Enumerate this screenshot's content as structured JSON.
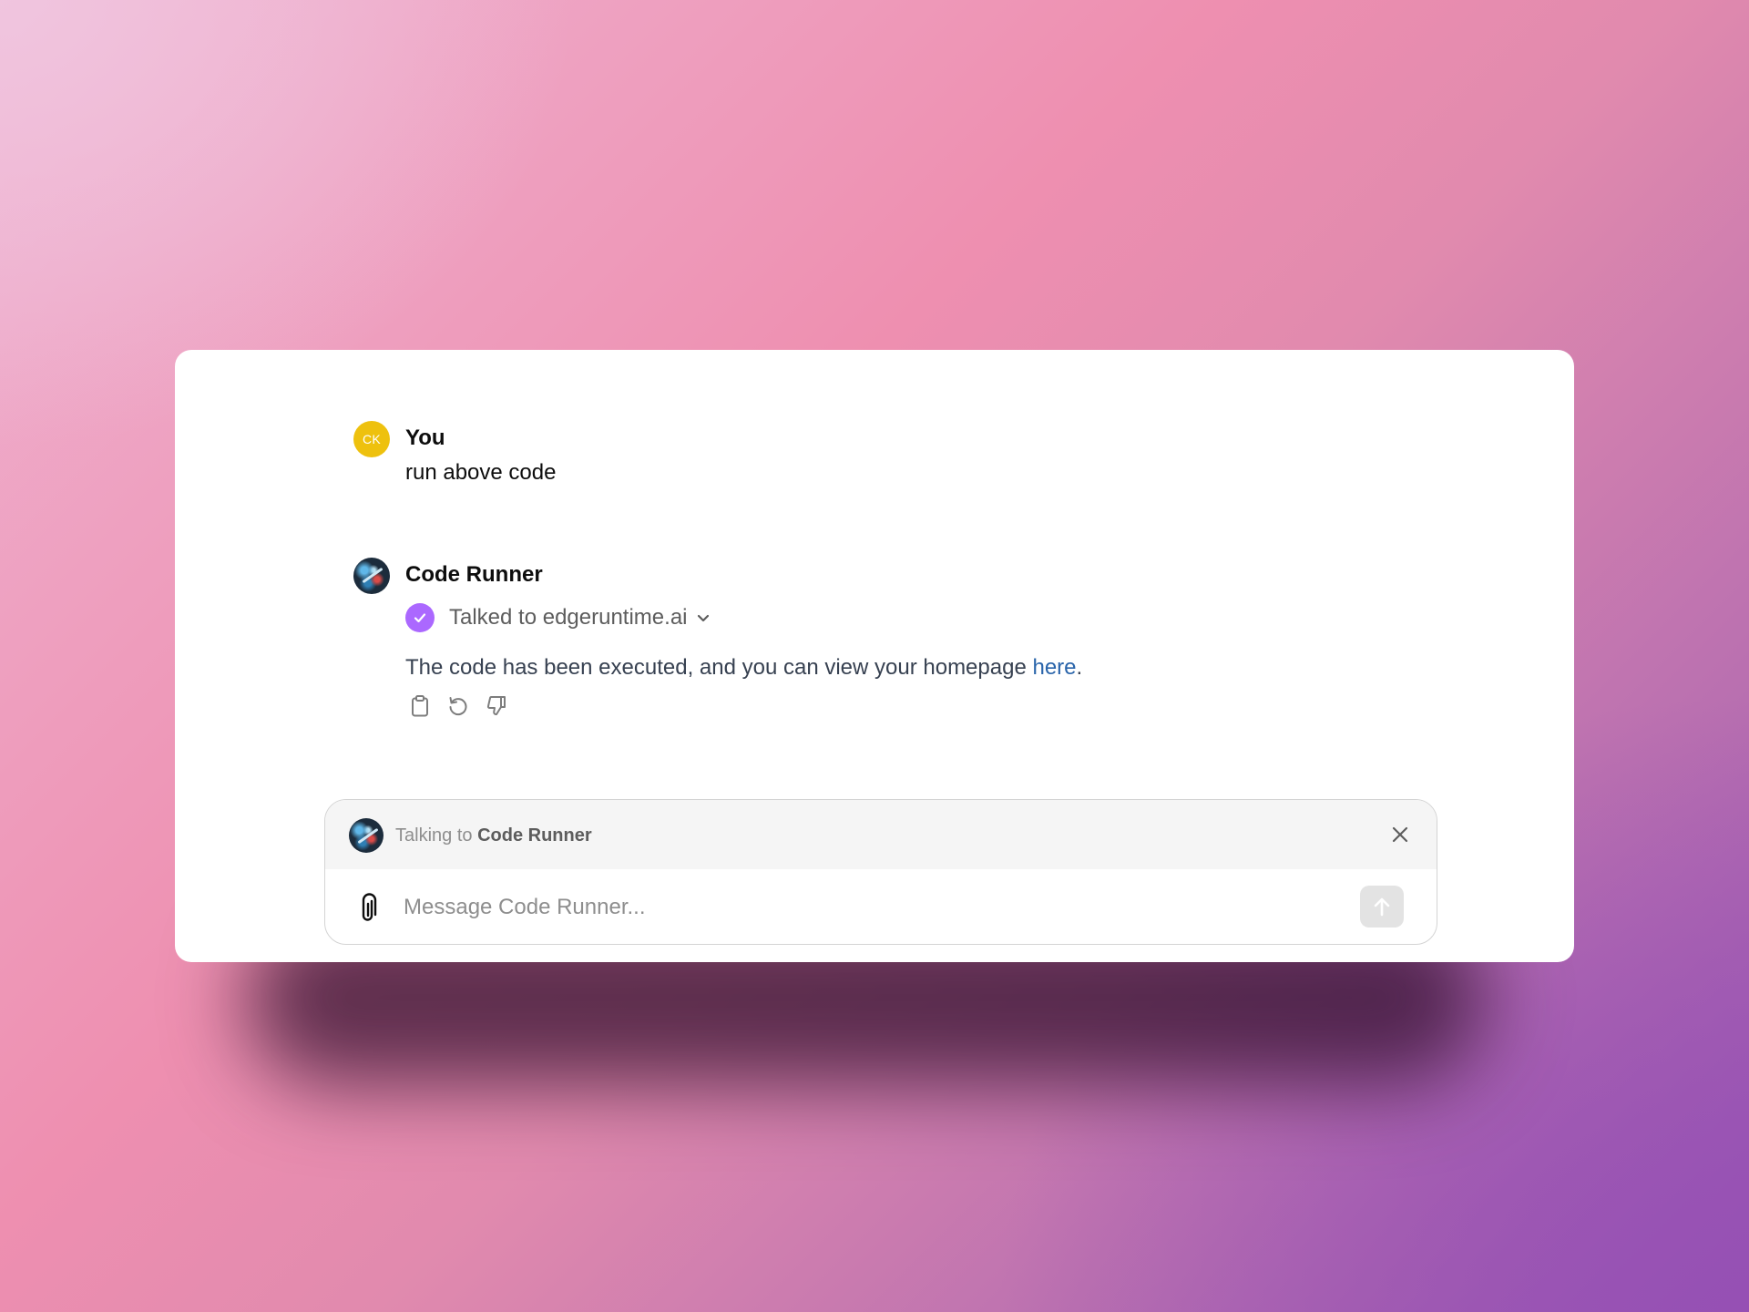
{
  "conversation": {
    "user_message": {
      "avatar_initials": "CK",
      "author": "You",
      "text": "run above code"
    },
    "assistant_message": {
      "author": "Code Runner",
      "tool_status": "Talked to edgeruntime.ai",
      "text_before_link": "The code has been executed, and you can view your homepage ",
      "link_text": "here",
      "text_after_link": ".",
      "actions": [
        "copy-icon",
        "regenerate-icon",
        "thumbs-down-icon"
      ]
    }
  },
  "composer": {
    "talking_prefix": "Talking to ",
    "talking_target": "Code Runner",
    "placeholder": "Message Code Runner..."
  },
  "colors": {
    "check_badge": "#ab68ff",
    "user_avatar": "#eec10e",
    "link": "#2964aa"
  }
}
